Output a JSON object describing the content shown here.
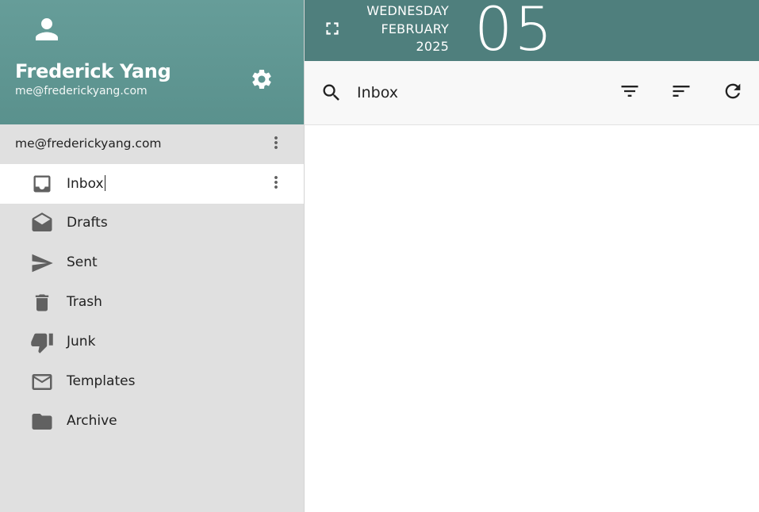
{
  "profile": {
    "name": "Frederick Yang",
    "email": "me@frederickyang.com"
  },
  "account": {
    "label": "me@frederickyang.com"
  },
  "folders": [
    {
      "label": "Inbox",
      "icon": "inbox-icon",
      "active": true
    },
    {
      "label": "Drafts",
      "icon": "drafts-icon",
      "active": false
    },
    {
      "label": "Sent",
      "icon": "send-icon",
      "active": false
    },
    {
      "label": "Trash",
      "icon": "trash-icon",
      "active": false
    },
    {
      "label": "Junk",
      "icon": "thumbs-down-icon",
      "active": false
    },
    {
      "label": "Templates",
      "icon": "envelope-icon",
      "active": false
    },
    {
      "label": "Archive",
      "icon": "folder-icon",
      "active": false
    }
  ],
  "date": {
    "weekday": "WEDNESDAY",
    "month": "FEBRUARY",
    "year": "2025",
    "day": "05"
  },
  "search": {
    "value": "Inbox"
  },
  "colors": {
    "profile_bg": "#669d99",
    "header_bg": "#4f7f7d",
    "sidebar_bg": "#e0e0e0",
    "icon_gray": "#616161"
  }
}
